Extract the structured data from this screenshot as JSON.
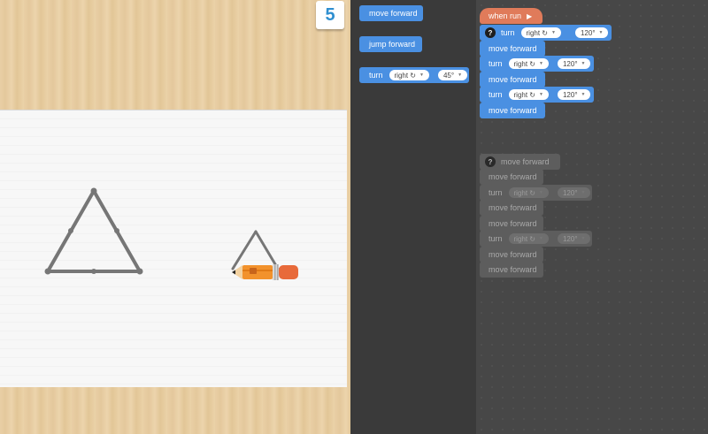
{
  "level": "5",
  "toolbox": {
    "move_forward": "move forward",
    "jump_forward": "jump forward",
    "turn": {
      "label": "turn",
      "direction": "right ↻",
      "angle": "45°"
    }
  },
  "program": {
    "when_run": "when run",
    "question_mark": "?",
    "blocks": [
      {
        "type": "turn",
        "label": "turn",
        "direction": "right ↻",
        "angle": "120°"
      },
      {
        "type": "move",
        "label": "move forward"
      },
      {
        "type": "turn",
        "label": "turn",
        "direction": "right ↻",
        "angle": "120°"
      },
      {
        "type": "move",
        "label": "move forward"
      },
      {
        "type": "turn",
        "label": "turn",
        "direction": "right ↻",
        "angle": "120°"
      },
      {
        "type": "move",
        "label": "move forward"
      }
    ]
  },
  "ghost": {
    "question_mark": "?",
    "blocks": [
      {
        "type": "move",
        "label": "move forward"
      },
      {
        "type": "move",
        "label": "move forward"
      },
      {
        "type": "turn",
        "label": "turn",
        "direction": "right ↻",
        "angle": "120°"
      },
      {
        "type": "move",
        "label": "move forward"
      },
      {
        "type": "move",
        "label": "move forward"
      },
      {
        "type": "turn",
        "label": "turn",
        "direction": "right ↻",
        "angle": "120°"
      },
      {
        "type": "move",
        "label": "move forward"
      },
      {
        "type": "move",
        "label": "move forward"
      }
    ]
  },
  "colors": {
    "block_blue": "#4a90e2",
    "event_orange": "#e07b5a",
    "ghost_gray": "#5d5d5d",
    "line_gray": "#767676"
  }
}
